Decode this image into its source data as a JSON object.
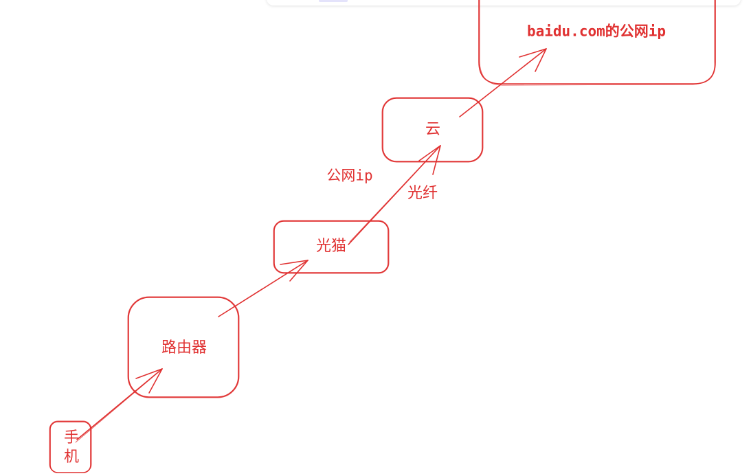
{
  "diagram": {
    "stroke_color": "#e03131",
    "nodes": [
      {
        "id": "phone",
        "label": "手机"
      },
      {
        "id": "router",
        "label": "路由器"
      },
      {
        "id": "modem",
        "label": "光猫"
      },
      {
        "id": "cloud",
        "label": "云"
      },
      {
        "id": "baidu",
        "label": "baidu.com的公网ip"
      }
    ],
    "annotations": {
      "public_ip": "公网ip",
      "fiber": "光纤"
    },
    "edges": [
      {
        "from": "phone",
        "to": "router"
      },
      {
        "from": "router",
        "to": "modem"
      },
      {
        "from": "modem",
        "to": "cloud"
      },
      {
        "from": "cloud",
        "to": "baidu"
      }
    ]
  }
}
